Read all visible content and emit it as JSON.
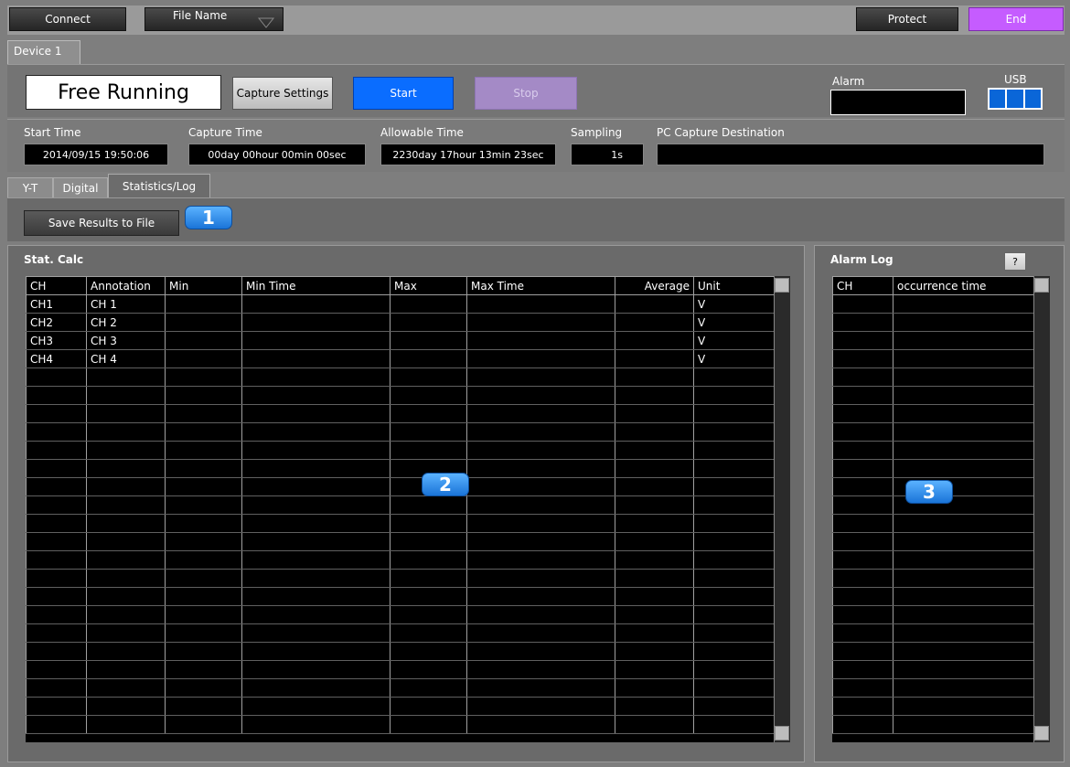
{
  "toolbar": {
    "connect_label": "Connect",
    "file_name_label": "File Name",
    "protect_label": "Protect",
    "end_label": "End"
  },
  "device_tab": "Device 1",
  "control": {
    "mode_text": "Free Running",
    "capture_settings_label": "Capture Settings",
    "start_label": "Start",
    "stop_label": "Stop",
    "alarm_label": "Alarm",
    "usb_label": "USB"
  },
  "info": {
    "start_time_label": "Start Time",
    "start_time_value": "2014/09/15 19:50:06",
    "capture_time_label": "Capture Time",
    "capture_time_value": "00day 00hour 00min 00sec",
    "allowable_time_label": "Allowable Time",
    "allowable_time_value": "2230day 17hour 13min 23sec",
    "sampling_label": "Sampling",
    "sampling_value": "1s",
    "pc_dest_label": "PC Capture Destination",
    "pc_dest_value": ""
  },
  "view_tabs": [
    "Y-T",
    "Digital",
    "Statistics/Log"
  ],
  "save_results_label": "Save Results to File",
  "badges": [
    "1",
    "2",
    "3"
  ],
  "stat": {
    "title": "Stat. Calc",
    "columns": [
      "CH",
      "Annotation",
      "Min",
      "Min Time",
      "Max",
      "Max Time",
      "Average",
      "Unit"
    ],
    "rows": [
      [
        "CH1",
        "CH 1",
        "",
        "",
        "",
        "",
        "",
        "V"
      ],
      [
        "CH2",
        "CH 2",
        "",
        "",
        "",
        "",
        "",
        "V"
      ],
      [
        "CH3",
        "CH 3",
        "",
        "",
        "",
        "",
        "",
        "V"
      ],
      [
        "CH4",
        "CH 4",
        "",
        "",
        "",
        "",
        "",
        "V"
      ]
    ]
  },
  "alarm_log": {
    "title": "Alarm Log",
    "help_label": "?",
    "columns": [
      "CH",
      "occurrence time"
    ]
  }
}
